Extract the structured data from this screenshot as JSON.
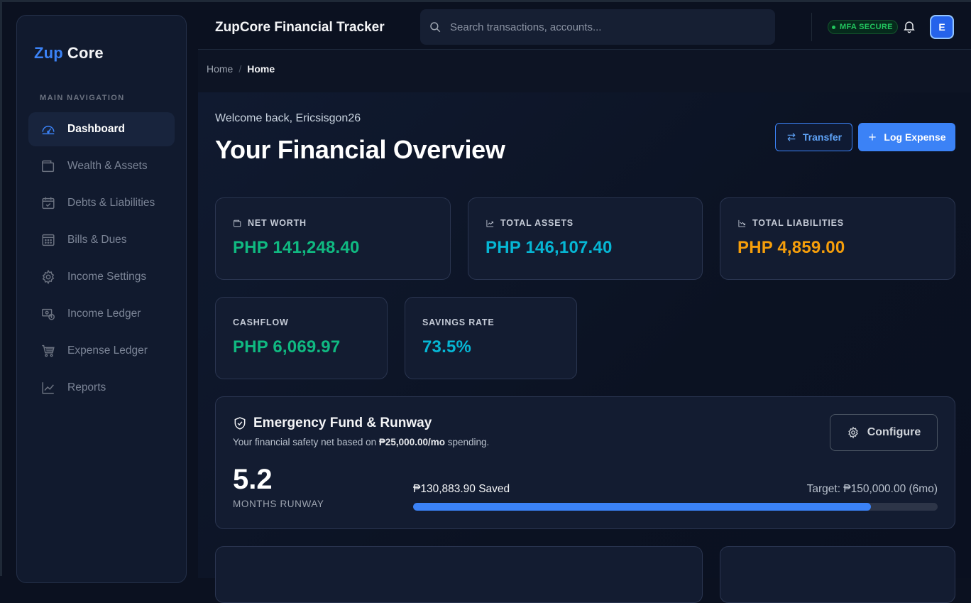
{
  "brand": {
    "part1": "Zup",
    "part2": "Core"
  },
  "sidebar": {
    "heading": "MAIN NAVIGATION",
    "items": [
      {
        "label": "Dashboard",
        "icon": "gauge-icon",
        "active": true
      },
      {
        "label": "Wealth & Assets",
        "icon": "wallet-icon"
      },
      {
        "label": "Debts & Liabilities",
        "icon": "calendar-check-icon"
      },
      {
        "label": "Bills & Dues",
        "icon": "calculator-icon"
      },
      {
        "label": "Income Settings",
        "icon": "gear-icon"
      },
      {
        "label": "Income Ledger",
        "icon": "cash-coin-icon"
      },
      {
        "label": "Expense Ledger",
        "icon": "cart-icon"
      },
      {
        "label": "Reports",
        "icon": "line-chart-icon"
      }
    ]
  },
  "topbar": {
    "title": "ZupCore Financial Tracker",
    "search_placeholder": "Search transactions, accounts...",
    "mfa_badge": "MFA SECURE",
    "avatar_initial": "E"
  },
  "breadcrumb": {
    "home": "Home",
    "separator": "/",
    "current": "Home"
  },
  "main": {
    "welcome": "Welcome back, Ericsisgon26",
    "title": "Your Financial Overview",
    "transfer_label": "Transfer",
    "log_expense_label": "Log Expense"
  },
  "stats": {
    "net_worth": {
      "label": "NET WORTH",
      "value": "PHP 141,248.40",
      "color": "#10b981"
    },
    "total_assets": {
      "label": "TOTAL ASSETS",
      "value": "PHP 146,107.40",
      "color": "#06b6d4"
    },
    "total_liabilities": {
      "label": "TOTAL LIABILITIES",
      "value": "PHP 4,859.00",
      "color": "#f59e0b"
    },
    "cashflow": {
      "label": "CASHFLOW",
      "value": "PHP 6,069.97",
      "color": "#10b981"
    },
    "savings_rate": {
      "label": "SAVINGS RATE",
      "value": "73.5%",
      "color": "#06b6d4"
    }
  },
  "emergency_fund": {
    "title": "Emergency Fund & Runway",
    "subtitle_pre": "Your financial safety net based on ",
    "monthly_spending": "₱25,000.00/mo",
    "subtitle_post": " spending.",
    "configure_label": "Configure",
    "runway_months": "5.2",
    "runway_label": "MONTHS RUNWAY",
    "saved_text": "₱130,883.90 Saved",
    "target_text": "Target: ₱150,000.00 (6mo)",
    "progress_fraction": 0.8726
  }
}
